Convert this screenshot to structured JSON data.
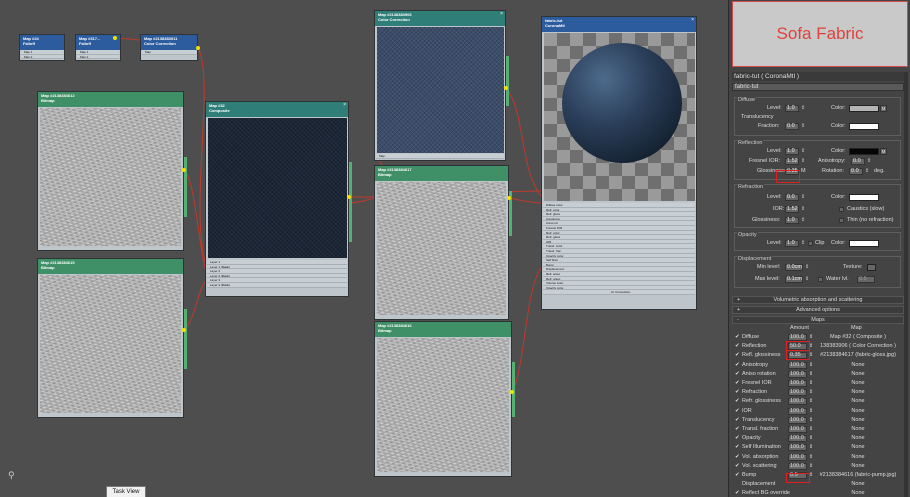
{
  "annotation_title": "Sofa Fabric",
  "nodes": {
    "falloff1": {
      "title": "Map #24",
      "type": "Falloff",
      "slots": [
        "Map 1",
        "Map 2"
      ]
    },
    "falloff2": {
      "title": "Map #317...",
      "type": "Falloff",
      "slots": [
        "Map 1",
        "Map 2"
      ]
    },
    "cc_small": {
      "title": "Map #2138383911",
      "type": "Color Correction",
      "slots": [
        "Map"
      ]
    },
    "bitmap_a": {
      "title": "Map #2138384612",
      "type": "Bitmap"
    },
    "bitmap_b": {
      "title": "Map #2138384615",
      "type": "Bitmap"
    },
    "composite": {
      "title": "Map #32",
      "type": "Composite",
      "slots": [
        "Layer 1",
        "Layer 1 (Mask)",
        "Layer 2",
        "Layer 2 (Mask)",
        "Layer 3",
        "Layer 3 (Mask)"
      ]
    },
    "cc_big": {
      "title": "Map #2138383906",
      "type": "Color Correction",
      "slots": [
        "Map"
      ]
    },
    "bitmap_c": {
      "title": "Map #2138384617",
      "type": "Bitmap"
    },
    "bitmap_d": {
      "title": "Map #2138384616",
      "type": "Bitmap"
    },
    "material": {
      "title": "fabric-tut",
      "type": "CoronaMtl",
      "slots": [
        "Diffuse color",
        "Refl. color",
        "Refl. gloss",
        "Anisotropy",
        "Aniso rot",
        "Fresnel IOR",
        "Refr. color",
        "Refr. gloss",
        "IOR",
        "Transl. color",
        "Transl. frac.",
        "Opacity color",
        "Self illum",
        "Bump",
        "Displacement",
        "Refl. aniso",
        "Refr. aniso",
        "Volume color",
        "Opacity color"
      ],
      "footer": "mr Connection"
    }
  },
  "task_view": "Task View",
  "panel": {
    "material_header": "fabric-tut  ( CoronaMtl )",
    "material_name": "fabric-tut",
    "diffuse": {
      "title": "Diffuse",
      "level_label": "Level:",
      "level": "1.0",
      "color_label": "Color:",
      "m": "M",
      "translucency_title": "Translucency",
      "fraction_label": "Fraction:",
      "fraction": "0.0",
      "t_color_label": "Color:"
    },
    "reflection": {
      "title": "Reflection",
      "level_label": "Level:",
      "level": "1.0",
      "color_label": "Color:",
      "m": "M",
      "ior_label": "Fresnel IOR:",
      "ior": "1.52",
      "aniso_label": "Anisotropy:",
      "aniso": "0.0",
      "gloss_label": "Glossiness:",
      "gloss": "0.35",
      "gloss_m": "M",
      "rot_label": "Rotation:",
      "rot": "0.0",
      "deg": "deg."
    },
    "refraction": {
      "title": "Refraction",
      "level_label": "Level:",
      "level": "0.0",
      "color_label": "Color:",
      "ior_label": "IOR:",
      "ior": "1.52",
      "caustics": "Caustics (slow)",
      "gloss_label": "Glossiness:",
      "gloss": "1.0",
      "thin": "Thin (no refraction)"
    },
    "opacity": {
      "title": "Opacity",
      "level_label": "Level:",
      "level": "1.0",
      "clip": "Clip",
      "color_label": "Color:"
    },
    "displacement": {
      "title": "Displacement",
      "min_label": "Min level:",
      "min": "0.0cm",
      "texture_label": "Texture:",
      "max_label": "Max level:",
      "max": "0.1cm",
      "water_label": "Water lvl.",
      "water": "0.5"
    },
    "rollouts": {
      "volumetric": "Volumetric absorption and scattering",
      "advanced": "Advanced options",
      "maps": "Maps"
    },
    "maps_header": {
      "amount": "Amount",
      "map": "Map"
    },
    "maps": [
      {
        "check": "✔",
        "name": "Diffuse",
        "amount": "100.0",
        "map": "Map #32  ( Composite )"
      },
      {
        "check": "✔",
        "name": "Reflection",
        "amount": "50.0",
        "map": "138383906  ( Color Correction )"
      },
      {
        "check": "✔",
        "name": "Refl. glossiness",
        "amount": "0.35",
        "map": "#2138384617 (fabric-gloss.jpg)"
      },
      {
        "check": "✔",
        "name": "Anisotropy",
        "amount": "100.0",
        "map": "None"
      },
      {
        "check": "✔",
        "name": "Aniso rotation",
        "amount": "100.0",
        "map": "None"
      },
      {
        "check": "✔",
        "name": "Fresnel IOR",
        "amount": "100.0",
        "map": "None"
      },
      {
        "check": "✔",
        "name": "Refraction",
        "amount": "100.0",
        "map": "None"
      },
      {
        "check": "✔",
        "name": "Refr. glossiness",
        "amount": "100.0",
        "map": "None"
      },
      {
        "check": "✔",
        "name": "IOR",
        "amount": "100.0",
        "map": "None"
      },
      {
        "check": "✔",
        "name": "Translucency",
        "amount": "100.0",
        "map": "None"
      },
      {
        "check": "✔",
        "name": "Transl. fraction",
        "amount": "100.0",
        "map": "None"
      },
      {
        "check": "✔",
        "name": "Opacity",
        "amount": "100.0",
        "map": "None"
      },
      {
        "check": "✔",
        "name": "Self Illumination",
        "amount": "100.0",
        "map": "None"
      },
      {
        "check": "✔",
        "name": "Vol. absorption",
        "amount": "100.0",
        "map": "None"
      },
      {
        "check": "✔",
        "name": "Vol. scattering",
        "amount": "100.0",
        "map": "None"
      },
      {
        "check": "✔",
        "name": "Bump",
        "amount": "0.5",
        "map": "#2138384616 (fabric-pump.jpg)"
      },
      {
        "check": "",
        "name": "Displacement",
        "amount": "",
        "map": "None"
      },
      {
        "check": "✔",
        "name": "Reflect BG override",
        "amount": "",
        "map": "None"
      }
    ],
    "colors": {
      "diffuse_swatch": "#b4b4b4",
      "refl_swatch": "#050505",
      "white_swatch": "#ffffff",
      "highlight": "#e02020"
    }
  }
}
